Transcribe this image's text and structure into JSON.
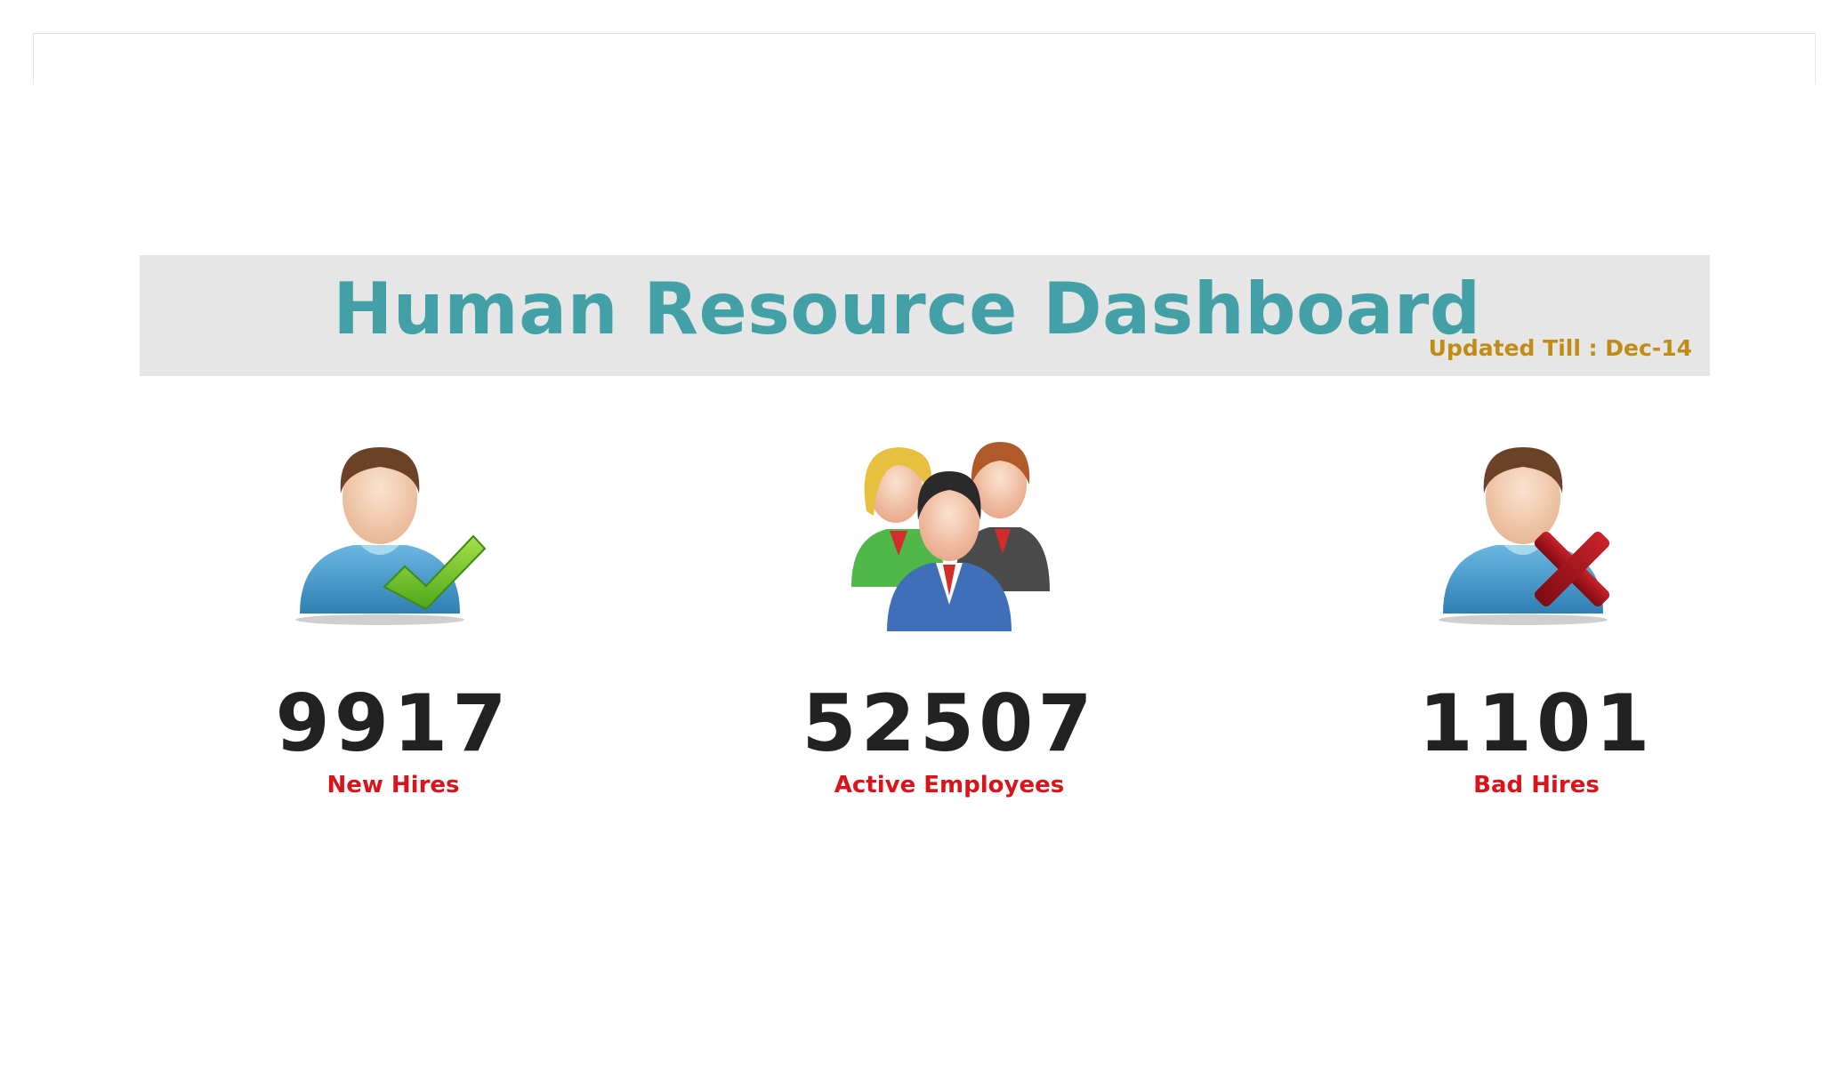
{
  "header": {
    "title": "Human Resource Dashboard",
    "updated": "Updated Till : Dec-14"
  },
  "kpis": [
    {
      "value": "9917",
      "label": "New Hires",
      "icon": "user-check-icon"
    },
    {
      "value": "52507",
      "label": "Active Employees",
      "icon": "group-users-icon"
    },
    {
      "value": "1101",
      "label": "Bad Hires",
      "icon": "user-cross-icon"
    }
  ],
  "colors": {
    "title": "#43a0a6",
    "updated": "#c08c16",
    "label": "#d9141b",
    "value": "#222222",
    "banner": "#e6e6e6"
  }
}
